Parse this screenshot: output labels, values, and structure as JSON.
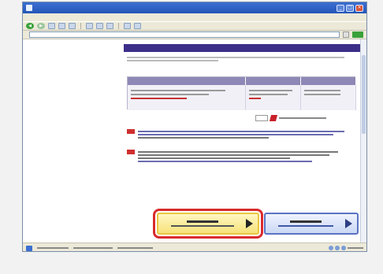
{
  "window": {
    "title": "",
    "controls": [
      "minimize-icon",
      "maximize-icon",
      "close-icon"
    ]
  },
  "menu": {
    "items": [
      "",
      "",
      "",
      "",
      "",
      "",
      ""
    ]
  },
  "toolbar": {
    "icons": [
      "back-arrow-icon",
      "forward-arrow-icon",
      "stop-icon",
      "refresh-icon",
      "home-icon",
      "search-icon",
      "favorites-icon",
      "history-icon",
      "mail-icon",
      "print-icon"
    ]
  },
  "address": {
    "label": "",
    "url": "",
    "go_label": ""
  },
  "page": {
    "section_title": "",
    "description": "",
    "env_heading": "",
    "table": {
      "headers": [
        "",
        "",
        ""
      ],
      "rows": [
        [
          "",
          "",
          ""
        ]
      ]
    },
    "reader_link": "",
    "note1": "",
    "note2": "",
    "cta_yes_title": "",
    "cta_yes_sub": "",
    "cta_no_title": "",
    "cta_no_sub": ""
  },
  "status": {
    "text": "",
    "zone": ""
  },
  "colors": {
    "titlebar": "#2456b8",
    "section_header": "#3c2f8a",
    "table_header": "#8d88b5",
    "cta_yes_fill": "#f6e27a",
    "cta_highlight": "#d92c2c",
    "cta_no_fill": "#cbd8f4",
    "note_tag": "#cf2f2f"
  }
}
